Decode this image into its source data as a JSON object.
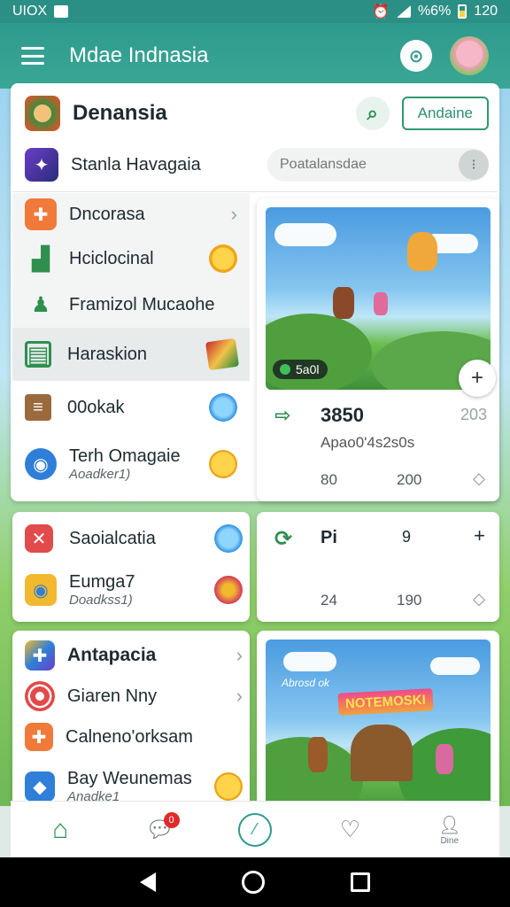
{
  "status": {
    "left": "UIOX",
    "right_battery": "%6%",
    "time": "120"
  },
  "appbar": {
    "title": "Mdae Indnasia"
  },
  "header": {
    "title": "Denansia",
    "button": "Andaine"
  },
  "search": {
    "label": "Stanla Havagaia",
    "placeholder": "Poatalansdae"
  },
  "menu": {
    "items": [
      {
        "label": "Dncorasa",
        "icon": "puzzle-icon",
        "color": "#f07a3a"
      },
      {
        "label": "Hciclocinal",
        "icon": "chart-icon",
        "color": "#2e8f4f"
      },
      {
        "label": "Framizol Mucaohe",
        "icon": "person-icon",
        "color": "#2e8f4f"
      },
      {
        "label": "Haraskion",
        "icon": "book-icon",
        "color": "#2e8f4f"
      },
      {
        "label": "00okak",
        "icon": "list-icon",
        "color": "#8a5a2c"
      },
      {
        "label": "Terh Omagaie",
        "sub": "Aoadker1)",
        "icon": "globe-icon",
        "color": "#2f7fd8"
      }
    ]
  },
  "menu2": {
    "items": [
      {
        "label": "Saoialcatia",
        "icon": "close-box-icon",
        "color": "#e14b4b"
      },
      {
        "label": "Eumga7",
        "sub": "Doadkss1)",
        "icon": "globe-icon",
        "color": "#f2b92f"
      }
    ]
  },
  "menu3": {
    "title": "Antapacia",
    "items": [
      {
        "label": "Giaren Nny",
        "icon": "target-icon",
        "color": "#e14b4b"
      },
      {
        "label": "Calneno'orksam",
        "icon": "puzzle-icon",
        "color": "#f07a3a"
      },
      {
        "label": "Bay Weunemas",
        "sub": "Anadke1",
        "icon": "diamond-icon",
        "color": "#2f7fd8"
      }
    ]
  },
  "game1": {
    "badge": "5a0l",
    "title": "3850",
    "right": "203",
    "subtitle": "Apao0'4s2s0s",
    "stats": [
      "80",
      "200"
    ]
  },
  "game2": {
    "title": "Pi",
    "count": "9",
    "stats": [
      "24",
      "190"
    ]
  },
  "game3": {
    "banner": "NOTEMOSKI",
    "caption": "Abrosd ok"
  },
  "nav": {
    "profile_label": "Dine",
    "badge": "0"
  }
}
